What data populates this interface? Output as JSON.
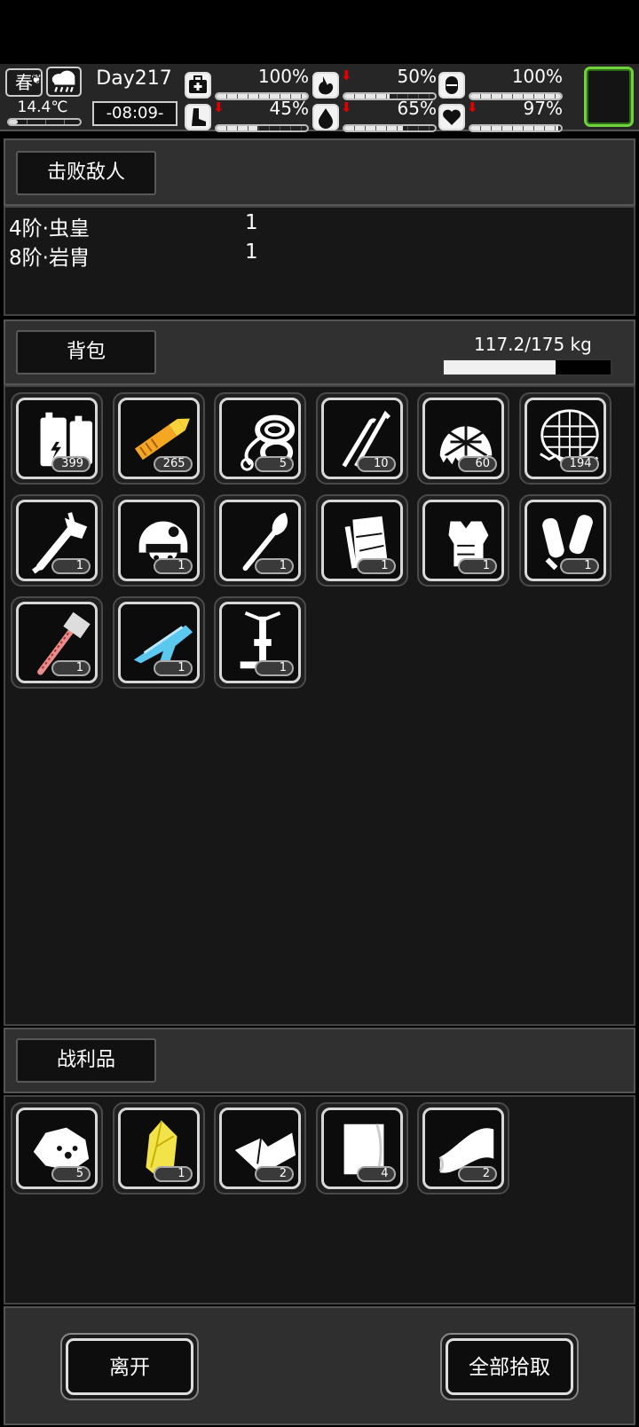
{
  "status": {
    "season": "春",
    "temperature": "14.4℃",
    "temperature_level": 0.12,
    "day": "Day217",
    "time": "-08:09-",
    "stats": [
      {
        "name": "health",
        "icon": "medkit-icon",
        "value": "100%",
        "fill": 1.0,
        "down": false
      },
      {
        "name": "hunger",
        "icon": "stomach-icon",
        "value": "50%",
        "fill": 0.5,
        "down": true
      },
      {
        "name": "armor",
        "icon": "capsule-icon",
        "value": "100%",
        "fill": 1.0,
        "down": false
      },
      {
        "name": "stamina",
        "icon": "foot-icon",
        "value": "45%",
        "fill": 0.45,
        "down": true
      },
      {
        "name": "thirst",
        "icon": "water-drop-icon",
        "value": "65%",
        "fill": 0.65,
        "down": true
      },
      {
        "name": "mood",
        "icon": "heart-icon",
        "value": "97%",
        "fill": 0.97,
        "down": true
      }
    ]
  },
  "defeated": {
    "title": "击败敌人",
    "enemies": [
      {
        "name": "4阶·虫皇",
        "count": "1"
      },
      {
        "name": "8阶·岩胄",
        "count": "1"
      }
    ]
  },
  "backpack": {
    "title": "背包",
    "weight": "117.2/175 kg",
    "weight_fraction": 0.67,
    "items": [
      {
        "icon": "battery-icon",
        "qty": "399"
      },
      {
        "icon": "bullet-cartridge-icon",
        "qty": "265"
      },
      {
        "icon": "rope-coil-icon",
        "qty": "5"
      },
      {
        "icon": "lockpick-icon",
        "qty": "10"
      },
      {
        "icon": "camo-net-helmet-icon",
        "qty": "60"
      },
      {
        "icon": "net-trap-icon",
        "qty": "194"
      },
      {
        "icon": "axe-icon",
        "qty": "1"
      },
      {
        "icon": "tactical-helmet-icon",
        "qty": "1"
      },
      {
        "icon": "shovel-icon",
        "qty": "1"
      },
      {
        "icon": "armor-plate-icon",
        "qty": "1"
      },
      {
        "icon": "body-armor-icon",
        "qty": "1"
      },
      {
        "icon": "leg-guards-icon",
        "qty": "1"
      },
      {
        "icon": "sledgehammer-icon",
        "qty": "1"
      },
      {
        "icon": "rifle-icon",
        "qty": "1"
      },
      {
        "icon": "tripod-stand-icon",
        "qty": "1"
      }
    ]
  },
  "loot": {
    "title": "战利品",
    "items": [
      {
        "icon": "ore-rock-icon",
        "qty": "5"
      },
      {
        "icon": "yellow-crystal-icon",
        "qty": "1"
      },
      {
        "icon": "cloth-scrap-icon",
        "qty": "2"
      },
      {
        "icon": "fabric-sheet-icon",
        "qty": "4"
      },
      {
        "icon": "folded-cloth-icon",
        "qty": "2"
      }
    ]
  },
  "actions": {
    "leave": "离开",
    "take_all": "全部拾取"
  }
}
